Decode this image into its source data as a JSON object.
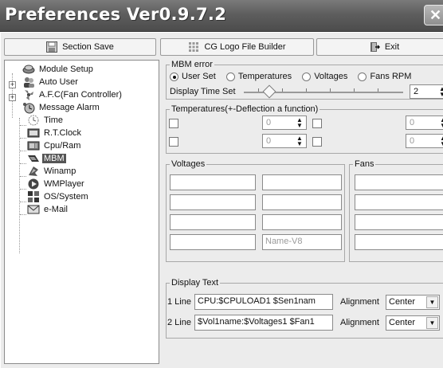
{
  "window": {
    "title": "Preferences Ver0.9.7.2",
    "close_symbol": "✕"
  },
  "toolbar": {
    "section_save": "Section Save",
    "logo_builder": "CG Logo File Builder",
    "exit": "Exit"
  },
  "tree": {
    "items": [
      {
        "label": "Module Setup",
        "icon": "module-setup-icon"
      },
      {
        "label": "Auto User",
        "icon": "auto-user-icon"
      },
      {
        "label": "A.F.C(Fan Controller)",
        "icon": "fan-controller-icon"
      },
      {
        "label": "Message Alarm",
        "icon": "message-alarm-icon"
      },
      {
        "label": "Time",
        "icon": "time-icon"
      },
      {
        "label": "R.T.Clock",
        "icon": "rt-clock-icon"
      },
      {
        "label": "Cpu/Ram",
        "icon": "cpu-ram-icon"
      },
      {
        "label": "MBM",
        "icon": "mbm-icon"
      },
      {
        "label": "Winamp",
        "icon": "winamp-icon"
      },
      {
        "label": "WMPlayer",
        "icon": "wmplayer-icon"
      },
      {
        "label": "OS/System",
        "icon": "os-system-icon"
      },
      {
        "label": "e-Mail",
        "icon": "email-icon"
      }
    ],
    "selected": "MBM"
  },
  "mbm_error": {
    "caption": "MBM error",
    "options": [
      "User Set",
      "Temperatures",
      "Voltages",
      "Fans RPM"
    ],
    "selected": "User Set",
    "display_time_label": "Display Time Set",
    "display_time_value": "2"
  },
  "temperatures": {
    "caption": "Temperatures(+-Deflection a function)",
    "values": [
      "0",
      "0",
      "0",
      "0"
    ]
  },
  "voltages": {
    "caption": "Voltages",
    "fields": [
      "",
      "",
      "",
      "",
      "",
      "",
      "",
      "Name-V8"
    ]
  },
  "fans": {
    "caption": "Fans",
    "fields": [
      "",
      "",
      "",
      ""
    ]
  },
  "display_text": {
    "caption": "Display Text",
    "line1_label": "1 Line",
    "line1_value": "CPU:$CPULOAD1 $Sen1nam",
    "line2_label": "2 Line",
    "line2_value": "$Vol1name:$Voltages1 $Fan1",
    "alignment_label": "Alignment",
    "alignment1": "Center",
    "alignment2": "Center"
  }
}
